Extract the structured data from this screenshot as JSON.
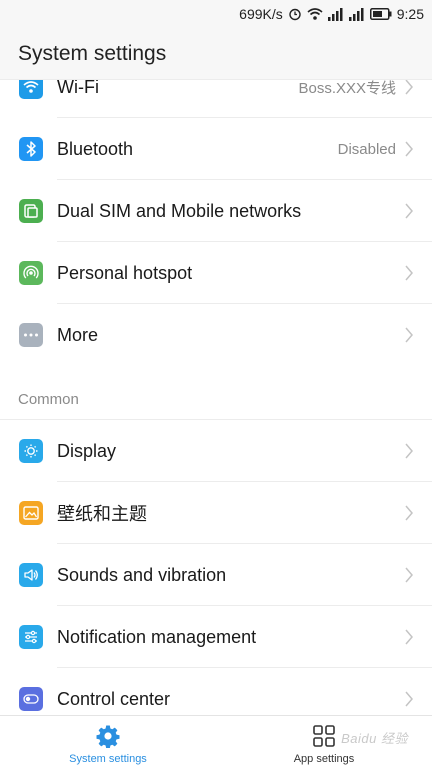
{
  "status_bar": {
    "speed": "699K/s",
    "time": "9:25",
    "icons": [
      "alarm-icon",
      "wifi-icon",
      "signal-icon",
      "signal-icon",
      "battery-icon"
    ]
  },
  "header": {
    "title": "System settings"
  },
  "rows_top": [
    {
      "label": "Wi-Fi",
      "value": "Boss.XXX专线",
      "icon": "wifi-icon",
      "color": "#1e9be8"
    },
    {
      "label": "Bluetooth",
      "value": "Disabled",
      "icon": "bluetooth-icon",
      "color": "#2196f3"
    },
    {
      "label": "Dual SIM and Mobile networks",
      "value": "",
      "icon": "sim-icon",
      "color": "#4caf50"
    },
    {
      "label": "Personal hotspot",
      "value": "",
      "icon": "hotspot-icon",
      "color": "#5cb85c"
    },
    {
      "label": "More",
      "value": "",
      "icon": "more-icon",
      "color": "#a9b2bd"
    }
  ],
  "section": {
    "label": "Common"
  },
  "rows_common": [
    {
      "label": "Display",
      "value": "",
      "icon": "brightness-icon",
      "color": "#29a9ea"
    },
    {
      "label": "壁纸和主题",
      "value": "",
      "icon": "wallpaper-icon",
      "color": "#f5a623"
    },
    {
      "label": "Sounds and vibration",
      "value": "",
      "icon": "speaker-icon",
      "color": "#29a9ea"
    },
    {
      "label": "Notification management",
      "value": "",
      "icon": "sliders-icon",
      "color": "#29a9ea"
    },
    {
      "label": "Control center",
      "value": "",
      "icon": "toggle-icon",
      "color": "#5a6fe0"
    }
  ],
  "bottom_nav": {
    "system_settings": "System settings",
    "app_settings": "App settings",
    "active_color": "#2a8fe0"
  },
  "watermark": "Baidu 经验"
}
